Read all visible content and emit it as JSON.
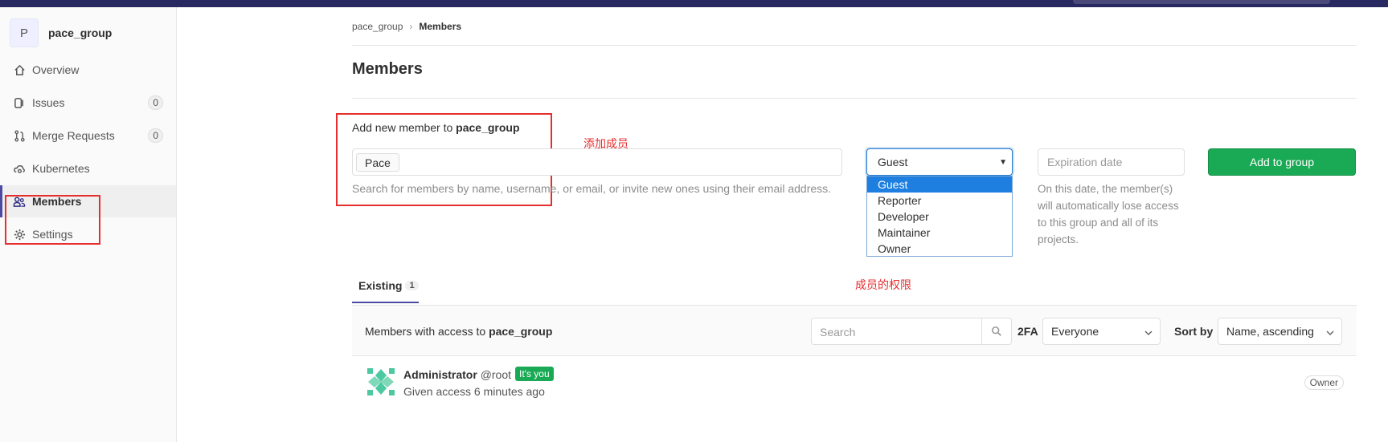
{
  "sidebar": {
    "group_initial": "P",
    "group_name": "pace_group",
    "items": [
      {
        "label": "Overview",
        "icon": "home-icon"
      },
      {
        "label": "Issues",
        "icon": "issues-icon",
        "count": "0"
      },
      {
        "label": "Merge Requests",
        "icon": "merge-request-icon",
        "count": "0"
      },
      {
        "label": "Kubernetes",
        "icon": "cloud-gear-icon"
      },
      {
        "label": "Members",
        "icon": "users-icon",
        "active": true
      },
      {
        "label": "Settings",
        "icon": "gear-icon"
      }
    ]
  },
  "breadcrumb": {
    "parent": "pace_group",
    "current": "Members"
  },
  "page_title": "Members",
  "add_member": {
    "prefix": "Add new member to ",
    "group": "pace_group",
    "token": "Pace",
    "help": "Search for members by name, username, or email, or invite new ones using their email address."
  },
  "role": {
    "selected": "Guest",
    "options": [
      "Guest",
      "Reporter",
      "Developer",
      "Maintainer",
      "Owner"
    ]
  },
  "expiration": {
    "placeholder": "Expiration date",
    "help": "On this date, the member(s) will automatically lose access to this group and all of its projects."
  },
  "add_button": "Add to group",
  "annotations": {
    "add_member": "添加成员",
    "member_role": "成员的权限"
  },
  "tabs": {
    "existing_label": "Existing",
    "existing_count": "1"
  },
  "members_header": {
    "prefix": "Members with access to ",
    "group": "pace_group",
    "search_placeholder": "Search",
    "twofa_label": "2FA",
    "twofa_value": "Everyone",
    "sort_label": "Sort by",
    "sort_value": "Name, ascending"
  },
  "members": [
    {
      "name": "Administrator",
      "handle": "@root",
      "badge": "It's you",
      "sub": "Given access 6 minutes ago",
      "role": "Owner"
    }
  ],
  "colors": {
    "accent": "#4b4ba3",
    "primary_green": "#1aaa55",
    "annotation_red": "#e62e2e",
    "topbar": "#292961"
  }
}
